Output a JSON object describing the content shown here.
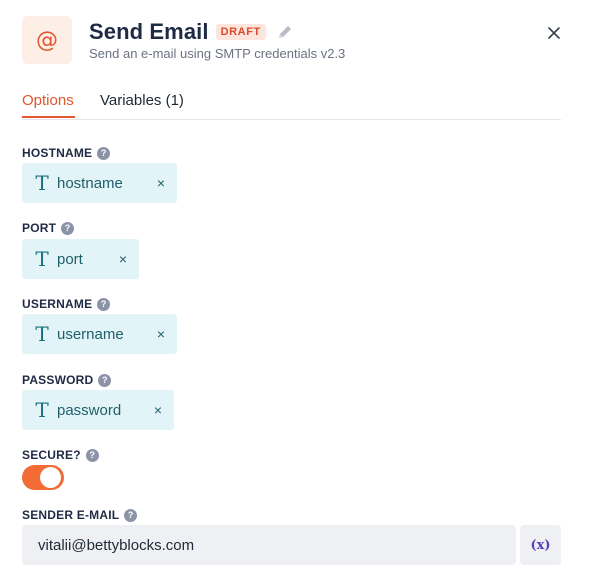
{
  "header": {
    "icon_glyph": "@",
    "icon_name": "at-sign-icon",
    "title": "Send Email",
    "badge": "DRAFT",
    "subtitle": "Send an e-mail using SMTP credentials v2.3"
  },
  "tabs": [
    {
      "label": "Options",
      "active": true
    },
    {
      "label": "Variables (1)",
      "active": false
    }
  ],
  "fields": {
    "hostname": {
      "label": "HOSTNAME",
      "help": "?",
      "chip_glyph": "T",
      "chip_value": "hostname",
      "remove": "×"
    },
    "port": {
      "label": "PORT",
      "help": "?",
      "chip_glyph": "T",
      "chip_value": "port",
      "remove": "×"
    },
    "username": {
      "label": "USERNAME",
      "help": "?",
      "chip_glyph": "T",
      "chip_value": "username",
      "remove": "×"
    },
    "password": {
      "label": "PASSWORD",
      "help": "?",
      "chip_glyph": "T",
      "chip_value": "password",
      "remove": "×"
    },
    "secure": {
      "label": "SECURE?",
      "help": "?",
      "checked": true
    },
    "sender": {
      "label": "SENDER E-MAIL",
      "help": "?",
      "value": "vitalii@bettyblocks.com",
      "variable_button": "(x)"
    }
  },
  "colors": {
    "accent": "#e3562f",
    "toggle_on": "#f26a34",
    "chip_bg": "#e2f4f7",
    "chip_text": "#1d5f6b",
    "variable_purple": "#5b3fb6"
  }
}
